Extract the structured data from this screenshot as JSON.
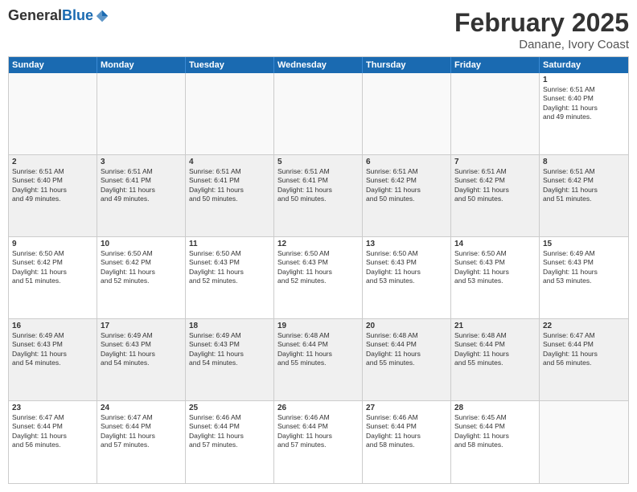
{
  "logo": {
    "general": "General",
    "blue": "Blue"
  },
  "header": {
    "title": "February 2025",
    "location": "Danane, Ivory Coast"
  },
  "weekdays": [
    "Sunday",
    "Monday",
    "Tuesday",
    "Wednesday",
    "Thursday",
    "Friday",
    "Saturday"
  ],
  "rows": [
    [
      {
        "day": "",
        "text": ""
      },
      {
        "day": "",
        "text": ""
      },
      {
        "day": "",
        "text": ""
      },
      {
        "day": "",
        "text": ""
      },
      {
        "day": "",
        "text": ""
      },
      {
        "day": "",
        "text": ""
      },
      {
        "day": "1",
        "text": "Sunrise: 6:51 AM\nSunset: 6:40 PM\nDaylight: 11 hours\nand 49 minutes."
      }
    ],
    [
      {
        "day": "2",
        "text": "Sunrise: 6:51 AM\nSunset: 6:40 PM\nDaylight: 11 hours\nand 49 minutes."
      },
      {
        "day": "3",
        "text": "Sunrise: 6:51 AM\nSunset: 6:41 PM\nDaylight: 11 hours\nand 49 minutes."
      },
      {
        "day": "4",
        "text": "Sunrise: 6:51 AM\nSunset: 6:41 PM\nDaylight: 11 hours\nand 50 minutes."
      },
      {
        "day": "5",
        "text": "Sunrise: 6:51 AM\nSunset: 6:41 PM\nDaylight: 11 hours\nand 50 minutes."
      },
      {
        "day": "6",
        "text": "Sunrise: 6:51 AM\nSunset: 6:42 PM\nDaylight: 11 hours\nand 50 minutes."
      },
      {
        "day": "7",
        "text": "Sunrise: 6:51 AM\nSunset: 6:42 PM\nDaylight: 11 hours\nand 50 minutes."
      },
      {
        "day": "8",
        "text": "Sunrise: 6:51 AM\nSunset: 6:42 PM\nDaylight: 11 hours\nand 51 minutes."
      }
    ],
    [
      {
        "day": "9",
        "text": "Sunrise: 6:50 AM\nSunset: 6:42 PM\nDaylight: 11 hours\nand 51 minutes."
      },
      {
        "day": "10",
        "text": "Sunrise: 6:50 AM\nSunset: 6:42 PM\nDaylight: 11 hours\nand 52 minutes."
      },
      {
        "day": "11",
        "text": "Sunrise: 6:50 AM\nSunset: 6:43 PM\nDaylight: 11 hours\nand 52 minutes."
      },
      {
        "day": "12",
        "text": "Sunrise: 6:50 AM\nSunset: 6:43 PM\nDaylight: 11 hours\nand 52 minutes."
      },
      {
        "day": "13",
        "text": "Sunrise: 6:50 AM\nSunset: 6:43 PM\nDaylight: 11 hours\nand 53 minutes."
      },
      {
        "day": "14",
        "text": "Sunrise: 6:50 AM\nSunset: 6:43 PM\nDaylight: 11 hours\nand 53 minutes."
      },
      {
        "day": "15",
        "text": "Sunrise: 6:49 AM\nSunset: 6:43 PM\nDaylight: 11 hours\nand 53 minutes."
      }
    ],
    [
      {
        "day": "16",
        "text": "Sunrise: 6:49 AM\nSunset: 6:43 PM\nDaylight: 11 hours\nand 54 minutes."
      },
      {
        "day": "17",
        "text": "Sunrise: 6:49 AM\nSunset: 6:43 PM\nDaylight: 11 hours\nand 54 minutes."
      },
      {
        "day": "18",
        "text": "Sunrise: 6:49 AM\nSunset: 6:43 PM\nDaylight: 11 hours\nand 54 minutes."
      },
      {
        "day": "19",
        "text": "Sunrise: 6:48 AM\nSunset: 6:44 PM\nDaylight: 11 hours\nand 55 minutes."
      },
      {
        "day": "20",
        "text": "Sunrise: 6:48 AM\nSunset: 6:44 PM\nDaylight: 11 hours\nand 55 minutes."
      },
      {
        "day": "21",
        "text": "Sunrise: 6:48 AM\nSunset: 6:44 PM\nDaylight: 11 hours\nand 55 minutes."
      },
      {
        "day": "22",
        "text": "Sunrise: 6:47 AM\nSunset: 6:44 PM\nDaylight: 11 hours\nand 56 minutes."
      }
    ],
    [
      {
        "day": "23",
        "text": "Sunrise: 6:47 AM\nSunset: 6:44 PM\nDaylight: 11 hours\nand 56 minutes."
      },
      {
        "day": "24",
        "text": "Sunrise: 6:47 AM\nSunset: 6:44 PM\nDaylight: 11 hours\nand 57 minutes."
      },
      {
        "day": "25",
        "text": "Sunrise: 6:46 AM\nSunset: 6:44 PM\nDaylight: 11 hours\nand 57 minutes."
      },
      {
        "day": "26",
        "text": "Sunrise: 6:46 AM\nSunset: 6:44 PM\nDaylight: 11 hours\nand 57 minutes."
      },
      {
        "day": "27",
        "text": "Sunrise: 6:46 AM\nSunset: 6:44 PM\nDaylight: 11 hours\nand 58 minutes."
      },
      {
        "day": "28",
        "text": "Sunrise: 6:45 AM\nSunset: 6:44 PM\nDaylight: 11 hours\nand 58 minutes."
      },
      {
        "day": "",
        "text": ""
      }
    ]
  ]
}
